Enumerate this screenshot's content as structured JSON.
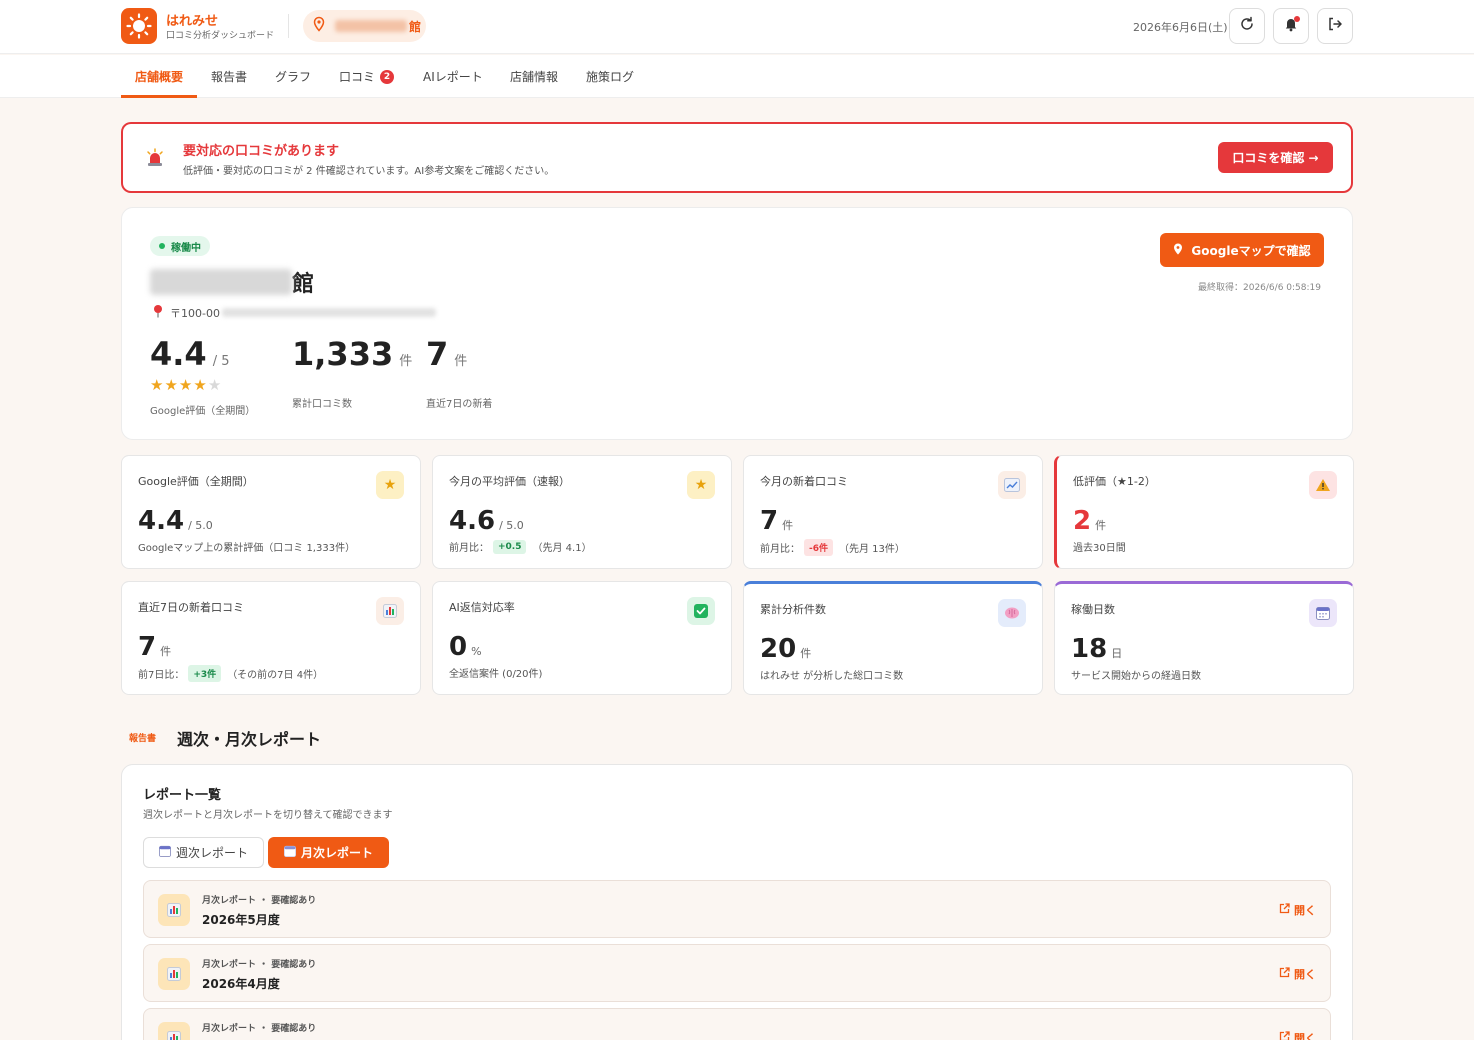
{
  "header": {
    "brand_name": "はれみせ",
    "brand_sub": "口コミ分析ダッシュボード",
    "store_suffix": "館",
    "date": "2026年6月6日(土)",
    "icons": [
      "sun-logo-icon",
      "map-pin-icon",
      "refresh-icon",
      "bell-icon",
      "logout-icon"
    ]
  },
  "tabs": [
    {
      "label": "店舗概要",
      "active": true
    },
    {
      "label": "報告書"
    },
    {
      "label": "グラフ"
    },
    {
      "label": "口コミ",
      "badge": "2"
    },
    {
      "label": "AIレポート"
    },
    {
      "label": "店舗情報"
    },
    {
      "label": "施策ログ"
    }
  ],
  "alert": {
    "title": "要対応の口コミがあります",
    "description": "低評価・要対応の口コミが 2 件確認されています。AI参考文案をご確認ください。",
    "button": "口コミを確認 →"
  },
  "store": {
    "status": "稼働中",
    "name_suffix": "館",
    "address_prefix": "〒100-00",
    "rating": "4.4",
    "rating_max": "/ 5",
    "stars_value": 4,
    "rating_label": "Google評価（全期間）",
    "total_reviews": "1,333",
    "total_unit": "件",
    "total_label": "累計口コミ数",
    "recent": "7",
    "recent_unit": "件",
    "recent_label": "直近7日の新着",
    "gmap_button": "Googleマップで確認",
    "last_fetch": "最終取得：2026/6/6 0:58:19"
  },
  "metrics": [
    {
      "title": "Google評価（全期間）",
      "value": "4.4",
      "unit": "/ 5.0",
      "sub": "Googleマップ上の累計評価（口コミ 1,333件）",
      "icon": "star-icon"
    },
    {
      "title": "今月の平均評価（速報）",
      "value": "4.6",
      "unit": "/ 5.0",
      "sub_prefix": "前月比：",
      "pill": "+0.5",
      "sub_suffix": "（先月 4.1）",
      "icon": "star-icon"
    },
    {
      "title": "今月の新着口コミ",
      "value": "7",
      "unit": "件",
      "sub_prefix": "前月比：",
      "pill": "-6件",
      "sub_suffix": "（先月 13件）",
      "icon": "trend-chart-icon"
    },
    {
      "title": "低評価（★1-2）",
      "value": "2",
      "unit": "件",
      "sub": "過去30日間",
      "icon": "warning-icon"
    },
    {
      "title": "直近7日の新着口コミ",
      "value": "7",
      "unit": "件",
      "sub_prefix": "前7日比：",
      "pill": "+3件",
      "sub_suffix": "（その前の7日 4件）",
      "icon": "bar-chart-icon"
    },
    {
      "title": "AI返信対応率",
      "value": "0",
      "unit": "%",
      "sub": "全返信案件 (0/20件)",
      "icon": "check-icon"
    },
    {
      "title": "累計分析件数",
      "value": "20",
      "unit": "件",
      "sub": "はれみせ が分析した総口コミ数",
      "icon": "brain-icon"
    },
    {
      "title": "稼働日数",
      "value": "18",
      "unit": "日",
      "sub": "サービス開始からの経過日数",
      "icon": "calendar-icon"
    }
  ],
  "colors": {
    "accent": "#f05a14",
    "danger": "#e5383b",
    "success": "#1a8a4a",
    "blue": "#4a7fd9",
    "purple": "#9a6ad6"
  },
  "section": {
    "tag": "報告書",
    "title": "週次・月次レポート"
  },
  "reports": {
    "title": "レポート一覧",
    "description": "週次レポートと月次レポートを切り替えて確認できます",
    "toggle_weekly": "週次レポート",
    "toggle_monthly": "月次レポート",
    "open_label": "開く",
    "items": [
      {
        "meta": "月次レポート ・ 要確認あり",
        "title": "2026年5月度"
      },
      {
        "meta": "月次レポート ・ 要確認あり",
        "title": "2026年4月度"
      },
      {
        "meta": "月次レポート ・ 要確認あり",
        "title": ""
      }
    ]
  }
}
